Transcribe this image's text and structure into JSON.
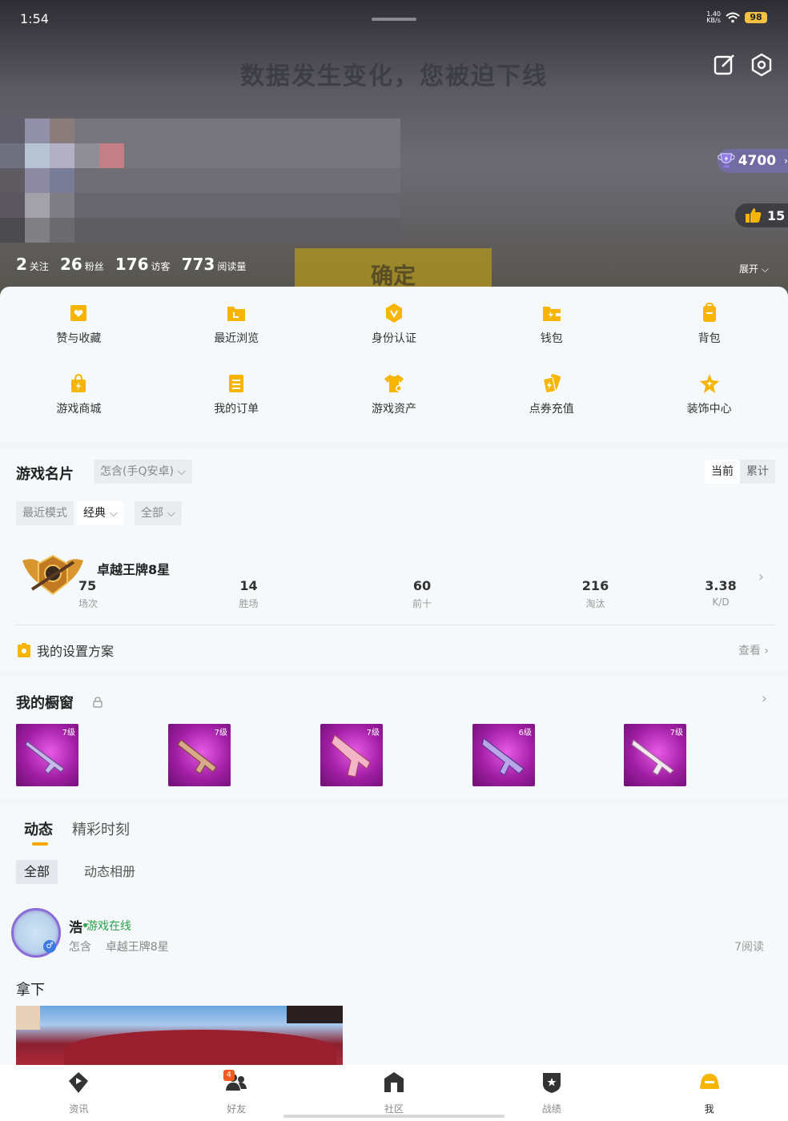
{
  "status_bar": {
    "time": "1:54",
    "net_speed_value": "1.40",
    "net_speed_unit": "KB/s",
    "battery": "98"
  },
  "header": {
    "banner_text": "数据发生变化，您被迫下线",
    "confirm_text": "确定",
    "trophy_points": "4700",
    "likes": "15",
    "stats": [
      {
        "value": "2",
        "label": "关注"
      },
      {
        "value": "26",
        "label": "粉丝"
      },
      {
        "value": "176",
        "label": "访客"
      },
      {
        "value": "773",
        "label": "阅读量"
      }
    ],
    "expand_label": "展开",
    "icons": {
      "edit": "edit-icon",
      "settings": "settings-icon"
    }
  },
  "quick_menu": [
    {
      "label": "赞与收藏",
      "icon": "heart-folder-icon"
    },
    {
      "label": "最近浏览",
      "icon": "history-folder-icon"
    },
    {
      "label": "身份认证",
      "icon": "verified-badge-icon"
    },
    {
      "label": "钱包",
      "icon": "wallet-icon"
    },
    {
      "label": "背包",
      "icon": "backpack-icon"
    },
    {
      "label": "游戏商城",
      "icon": "shopping-bag-icon"
    },
    {
      "label": "我的订单",
      "icon": "order-list-icon"
    },
    {
      "label": "游戏资产",
      "icon": "tshirt-icon"
    },
    {
      "label": "点券充值",
      "icon": "coupon-cards-icon"
    },
    {
      "label": "装饰中心",
      "icon": "star-sparkle-icon"
    }
  ],
  "game_card": {
    "title": "游戏名片",
    "account_selector": "怎含(手Q安卓)",
    "toggle": {
      "current": "当前",
      "total": "累计"
    },
    "mode_label": "最近模式",
    "mode_value": "经典",
    "scope_value": "全部",
    "rank": "卓越王牌8星",
    "stats": [
      {
        "value": "75",
        "label": "场次"
      },
      {
        "value": "14",
        "label": "胜场"
      },
      {
        "value": "60",
        "label": "前十"
      },
      {
        "value": "216",
        "label": "淘汰"
      },
      {
        "value": "3.38",
        "label": "K/D"
      }
    ],
    "settings_label": "我的设置方案",
    "view_label": "查看"
  },
  "showcase": {
    "title": "我的橱窗",
    "items": [
      {
        "level": "7级"
      },
      {
        "level": "7级"
      },
      {
        "level": "7级"
      },
      {
        "level": "6级"
      },
      {
        "level": "7级"
      }
    ]
  },
  "feed": {
    "tabs": [
      "动态",
      "精彩时刻"
    ],
    "filters": [
      "全部",
      "动态相册"
    ],
    "post": {
      "name": "浩",
      "status": "游戏在线",
      "account": "怎含",
      "rank": "卓越王牌8星",
      "read_count": "7阅读",
      "text": "拿下"
    }
  },
  "bottom_nav": [
    {
      "label": "资讯",
      "icon": "play-diamond-icon",
      "active": false
    },
    {
      "label": "好友",
      "icon": "friends-icon",
      "active": false,
      "badge": "4"
    },
    {
      "label": "社区",
      "icon": "community-house-icon",
      "active": false
    },
    {
      "label": "战绩",
      "icon": "shield-star-icon",
      "active": false
    },
    {
      "label": "我",
      "icon": "helmet-icon",
      "active": true
    }
  ],
  "colors": {
    "accent": "#f7a800",
    "online": "#2aa24a",
    "weapon_bg": "#a01ea3",
    "badge": "#f25a1e"
  }
}
